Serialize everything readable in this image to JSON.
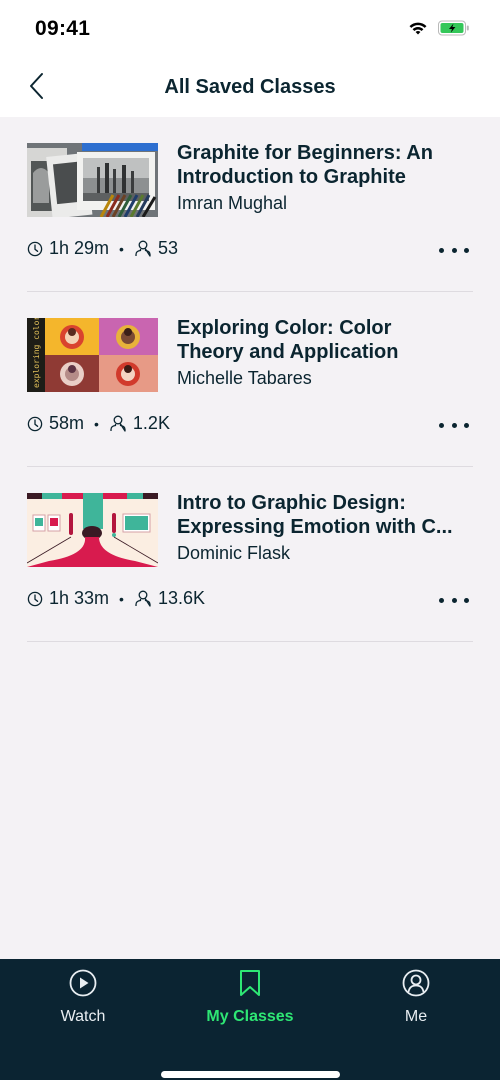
{
  "status_bar": {
    "time": "09:41",
    "icons": [
      "wifi-icon",
      "battery-charging-icon"
    ]
  },
  "header": {
    "back_icon": "chevron-left-icon",
    "title": "All Saved Classes"
  },
  "classes": [
    {
      "title_line1": "Graphite for Beginners: An",
      "title_line2": "Introduction to Graphite",
      "teacher": "Imran Mughal",
      "duration": "1h 29m",
      "students": "53",
      "thumbnail": "graphite-drawings-with-pencils"
    },
    {
      "title_line1": "Exploring Color: Color",
      "title_line2": "Theory and Application",
      "teacher": "Michelle Tabares",
      "duration": "58m",
      "students": "1.2K",
      "thumbnail": "exploring-color-portraits",
      "thumbnail_text": "exploring color"
    },
    {
      "title_line1": "Intro to Graphic Design:",
      "title_line2": "Expressing Emotion with C...",
      "teacher": "Dominic Flask",
      "duration": "1h 33m",
      "students": "13.6K",
      "thumbnail": "graphic-design-paint-spill"
    }
  ],
  "meta_separator": "•",
  "tab_bar": {
    "tabs": [
      {
        "label": "Watch",
        "icon": "play-circle-icon",
        "active": false
      },
      {
        "label": "My Classes",
        "icon": "bookmark-icon",
        "active": true
      },
      {
        "label": "Me",
        "icon": "user-circle-icon",
        "active": false
      }
    ]
  },
  "colors": {
    "accent": "#2ee674",
    "tab_bar_bg": "#0b2432",
    "text_primary": "#0b2530",
    "page_bg": "#f4f2f5"
  }
}
